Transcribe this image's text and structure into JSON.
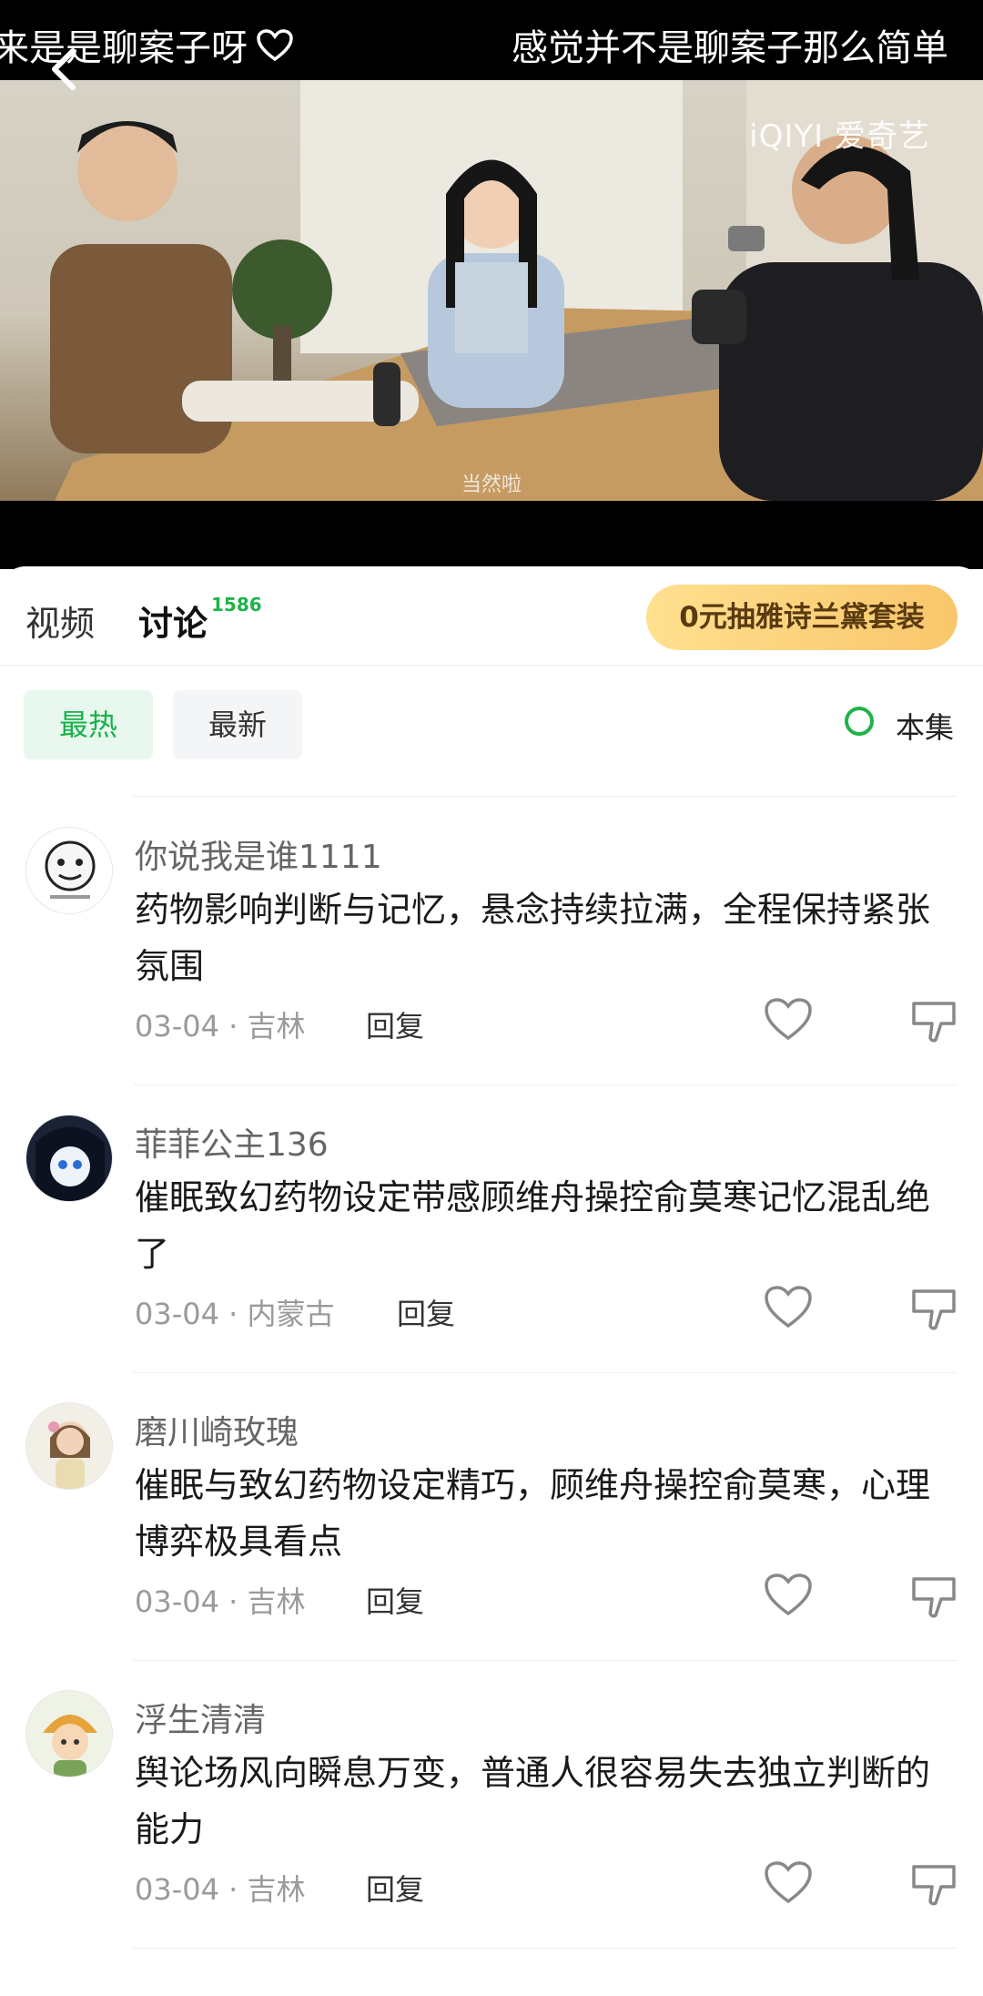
{
  "danmaku": {
    "left_text": "来是是聊案子呀",
    "right_text": "感觉并不是聊案子那么简单"
  },
  "video": {
    "watermark": "iQIYI 爱奇艺",
    "subtitle": "当然啦"
  },
  "tabs": {
    "video_label": "视频",
    "discuss_label": "讨论",
    "discuss_count": "1586",
    "promo_label": "0元抽雅诗兰黛套装"
  },
  "filters": {
    "hot_label": "最热",
    "new_label": "最新",
    "episode_label": "本集"
  },
  "comments": [
    {
      "user": "你说我是谁1111",
      "text": "药物影响判断与记忆，悬念持续拉满，全程保持紧张氛围",
      "date": "03-04",
      "location": "吉林",
      "reply_label": "回复"
    },
    {
      "user": "菲菲公主136",
      "text": "催眠致幻药物设定带感顾维舟操控俞莫寒记忆混乱绝了",
      "date": "03-04",
      "location": "内蒙古",
      "reply_label": "回复"
    },
    {
      "user": "磨川崎玫瑰",
      "text": "催眠与致幻药物设定精巧，顾维舟操控俞莫寒，心理博弈极具看点",
      "date": "03-04",
      "location": "吉林",
      "reply_label": "回复"
    },
    {
      "user": "浮生清清",
      "text": "舆论场风向瞬息万变，普通人很容易失去独立判断的能力",
      "date": "03-04",
      "location": "吉林",
      "reply_label": "回复"
    }
  ],
  "colors": {
    "accent_green": "#1fb34a",
    "promo_gold": "#f9c66b"
  },
  "icons": [
    "back-icon",
    "heart-icon",
    "like-icon",
    "dislike-icon"
  ]
}
